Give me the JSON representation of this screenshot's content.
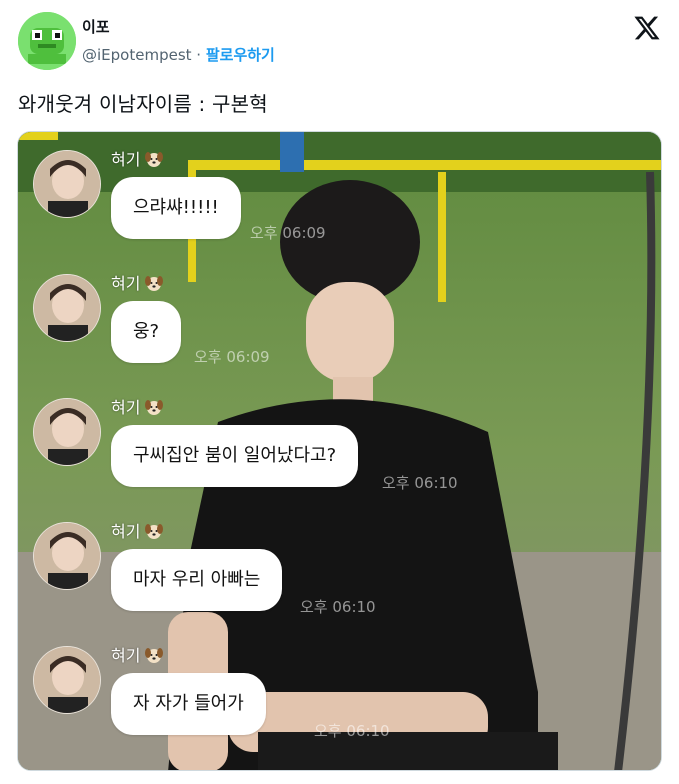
{
  "author": {
    "display_name": "이포",
    "handle": "@iEpotempest",
    "separator": "·",
    "follow_label": "팔로우하기"
  },
  "tweet": {
    "text": "와개웃겨 이남자이름 : 구본혁"
  },
  "chat": {
    "messages": [
      {
        "sender": "혀기",
        "text": "으랴쌰!!!!!",
        "time": "오후 06:09"
      },
      {
        "sender": "혀기",
        "text": "웅?",
        "time": "오후 06:09"
      },
      {
        "sender": "혀기",
        "text": "구씨집안 붐이 일어났다고?",
        "time": "오후 06:10"
      },
      {
        "sender": "혀기",
        "text": "마자 우리 아빠는",
        "time": "오후 06:10"
      },
      {
        "sender": "혀기",
        "text": "자 자가 들어가",
        "time": "오후 06:10"
      }
    ]
  },
  "icons": {
    "logo": "x-logo-icon",
    "sender_emoji": "dog-face-icon",
    "author_avatar": "green-frog-avatar"
  },
  "colors": {
    "follow": "#1d9bf0",
    "handle": "#536471",
    "avatar_bg": "#7ae06f"
  }
}
